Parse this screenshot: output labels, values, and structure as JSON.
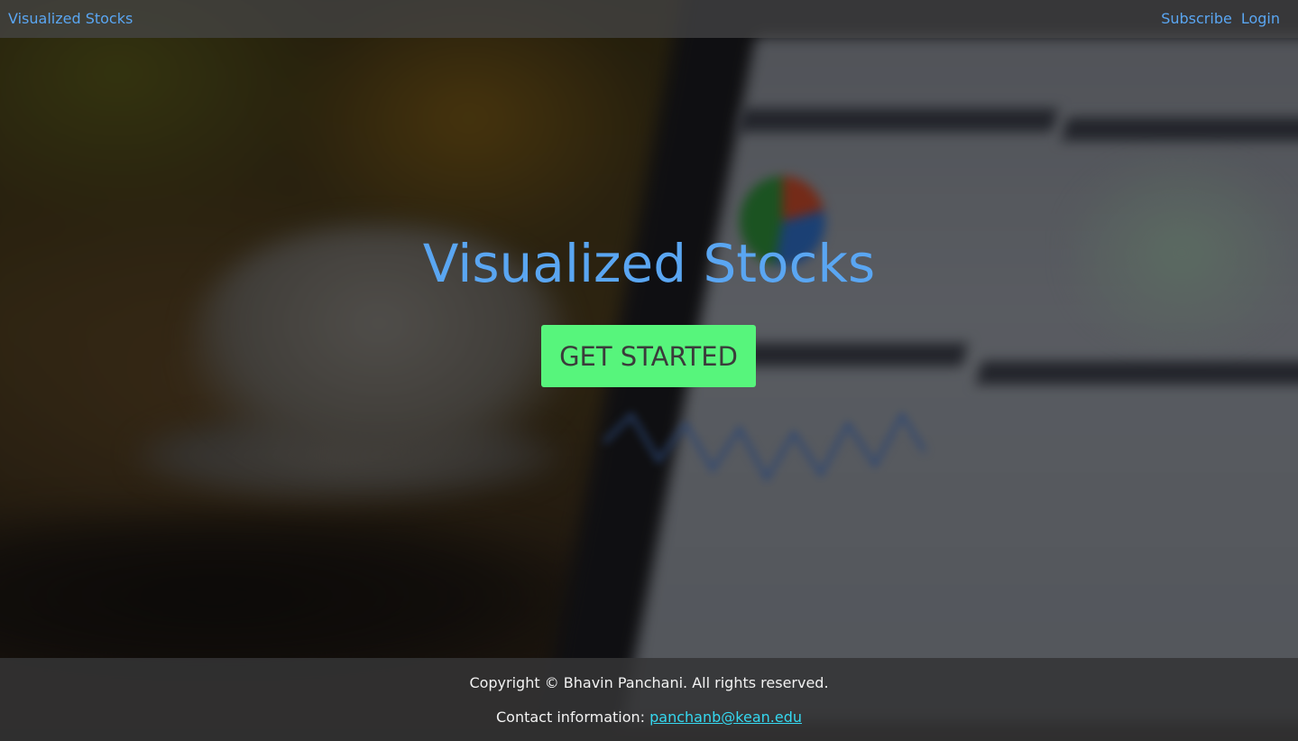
{
  "navbar": {
    "brand": "Visualized Stocks",
    "links": [
      "Subscribe",
      "Login"
    ]
  },
  "hero": {
    "title": "Visualized Stocks",
    "cta_label": "GET STARTED"
  },
  "footer": {
    "copyright": "Copyright © Bhavin Panchani. All rights reserved.",
    "contact_label": "Contact information: ",
    "contact_email": "panchanb@kean.edu"
  },
  "colors": {
    "accent_blue": "#5aa6f2",
    "cta_green": "#57f57c",
    "link_cyan": "#35d8f0",
    "bar_bg": "#464648"
  },
  "background": {
    "icon": "blurred-photo-coffee-cup-and-laptop-dashboard"
  }
}
